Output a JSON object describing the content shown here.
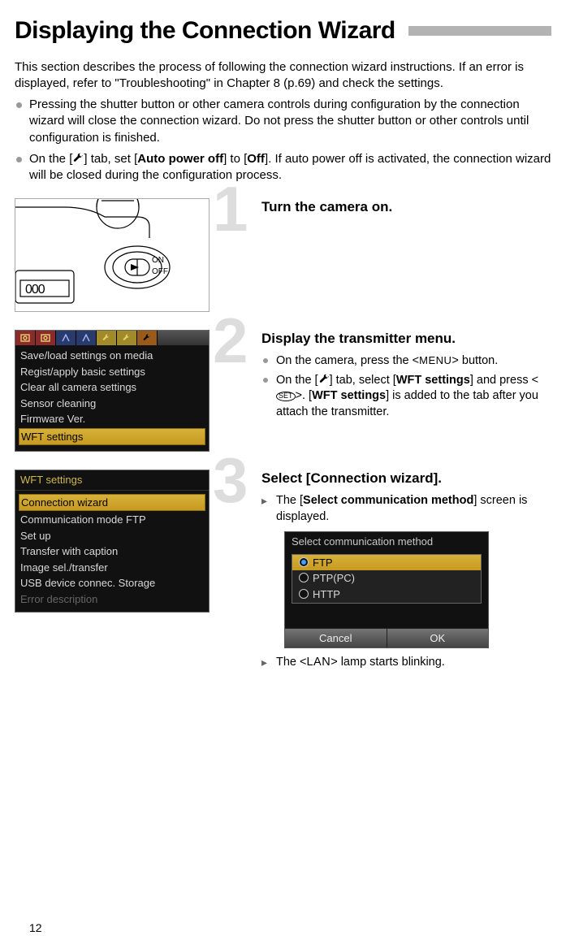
{
  "title": "Displaying the Connection Wizard",
  "intro": "This section describes the process of following the connection wizard instructions. If an error is displayed, refer to \"Troubleshooting\" in Chapter 8 (p.69) and check the settings.",
  "bullets": [
    {
      "prefix": "Pressing the shutter button or other camera controls during configuration by the connection wizard will close the connection wizard. Do not press the shutter button or other controls until configuration is finished."
    },
    {
      "parts": {
        "p1": "On the [",
        "p2": "] tab, set [",
        "b1": "Auto power off",
        "p3": "] to [",
        "b2": "Off",
        "p4": "]. If auto power off is activated, the connection wizard will be closed during the configuration process."
      }
    }
  ],
  "camera_labels": {
    "on": "ON",
    "off": "OFF"
  },
  "steps": {
    "s1": {
      "num": "1",
      "title": "Turn the camera on."
    },
    "s2": {
      "num": "2",
      "title": "Display the transmitter menu.",
      "items": [
        {
          "p1": "On the camera, press the <",
          "glyph": "MENU",
          "p2": "> button."
        },
        {
          "p1": "On the [",
          "p2": "] tab, select [",
          "b1": "WFT settings",
          "p3": "] and press <",
          "set": "SET",
          "p4": ">. [",
          "b2": "WFT settings",
          "p5": "] is added to the tab after you attach the transmitter."
        }
      ],
      "menu": {
        "items": [
          "Save/load settings on media",
          "Regist/apply basic settings",
          "Clear all camera settings",
          "Sensor cleaning",
          "Firmware Ver.",
          "WFT settings"
        ],
        "highlight_index": 5
      }
    },
    "s3": {
      "num": "3",
      "title": "Select [Connection wizard].",
      "result1": {
        "p1": "The [",
        "b1": "Select communication method",
        "p2": "] screen is displayed."
      },
      "result2": {
        "p1": "The <",
        "lan": "LAN",
        "p2": "> lamp starts blinking."
      },
      "menu": {
        "header": "WFT settings",
        "items": [
          "Connection wizard",
          "Communication mode FTP",
          "Set up",
          "Transfer with caption",
          "Image sel./transfer",
          "USB device connec. Storage",
          "Error description"
        ],
        "highlight_index": 0
      },
      "comm": {
        "title": "Select communication method",
        "options": [
          "FTP",
          "PTP(PC)",
          "HTTP"
        ],
        "selected_index": 0,
        "cancel": "Cancel",
        "ok": "OK"
      }
    }
  },
  "page_number": "12"
}
